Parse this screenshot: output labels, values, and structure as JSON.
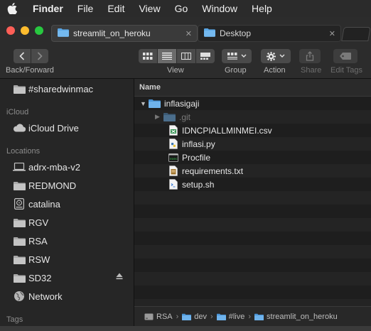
{
  "menubar": {
    "app": "Finder",
    "items": [
      "File",
      "Edit",
      "View",
      "Go",
      "Window",
      "Help"
    ]
  },
  "tabs": [
    {
      "label": "streamlit_on_heroku",
      "active": true
    },
    {
      "label": "Desktop",
      "active": false
    }
  ],
  "toolbar": {
    "nav_label": "Back/Forward",
    "view_label": "View",
    "group_label": "Group",
    "action_label": "Action",
    "share_label": "Share",
    "edit_tags_label": "Edit Tags"
  },
  "sidebar": {
    "top_item": "#sharedwinmac",
    "icloud_header": "iCloud",
    "icloud_items": [
      "iCloud Drive"
    ],
    "locations_header": "Locations",
    "locations": [
      "adrx-mba-v2",
      "REDMOND",
      "catalina",
      "RGV",
      "RSA",
      "RSW",
      "SD32",
      "Network"
    ],
    "tags_header": "Tags"
  },
  "file_list": {
    "column_name": "Name",
    "root_folder": "inflasigaji",
    "entries": [
      {
        "name": ".git",
        "kind": "folder-hidden"
      },
      {
        "name": "IDNCPIALLMINMEI.csv",
        "kind": "csv"
      },
      {
        "name": "inflasi.py",
        "kind": "python"
      },
      {
        "name": "Procfile",
        "kind": "exec"
      },
      {
        "name": "requirements.txt",
        "kind": "text"
      },
      {
        "name": "setup.sh",
        "kind": "shell"
      }
    ]
  },
  "pathbar": {
    "segments": [
      "RSA",
      "dev",
      "#live",
      "streamlit_on_heroku"
    ]
  },
  "colors": {
    "folder_blue": "#5aa7e6",
    "sidebar_bg": "#262626",
    "content_bg": "#1e1e1e"
  }
}
